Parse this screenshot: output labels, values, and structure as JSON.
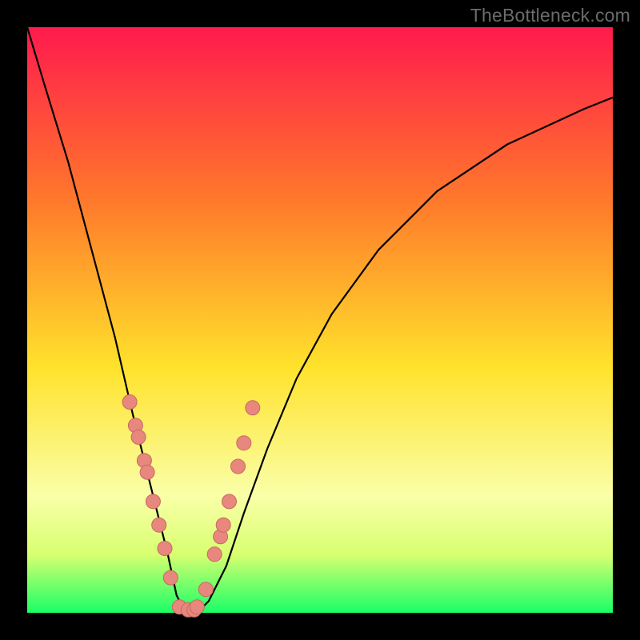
{
  "watermark": "TheBottleneck.com",
  "colors": {
    "frame": "#000000",
    "gradient_top": "#ff1a4d",
    "gradient_mid1": "#ff7a2b",
    "gradient_mid2": "#ffe22b",
    "gradient_low": "#faffa8",
    "gradient_band": "#d8ff70",
    "gradient_bottom": "#1aff66",
    "curve": "#000000",
    "marker_fill": "#e8877d",
    "marker_stroke": "#c56a60"
  },
  "chart_data": {
    "type": "line",
    "title": "",
    "xlabel": "",
    "ylabel": "",
    "xlim": [
      0,
      1
    ],
    "ylim": [
      0,
      1
    ],
    "series": [
      {
        "name": "bottleneck-curve",
        "x": [
          0.0,
          0.03,
          0.07,
          0.11,
          0.15,
          0.18,
          0.21,
          0.24,
          0.255,
          0.27,
          0.29,
          0.31,
          0.34,
          0.37,
          0.41,
          0.46,
          0.52,
          0.6,
          0.7,
          0.82,
          0.95,
          1.0
        ],
        "y": [
          1.0,
          0.9,
          0.77,
          0.62,
          0.47,
          0.34,
          0.22,
          0.1,
          0.03,
          0.0,
          0.0,
          0.02,
          0.08,
          0.17,
          0.28,
          0.4,
          0.51,
          0.62,
          0.72,
          0.8,
          0.86,
          0.88
        ]
      }
    ],
    "markers": {
      "name": "highlighted-points",
      "x": [
        0.175,
        0.185,
        0.19,
        0.2,
        0.205,
        0.215,
        0.225,
        0.235,
        0.245,
        0.26,
        0.275,
        0.285,
        0.29,
        0.305,
        0.32,
        0.33,
        0.335,
        0.345,
        0.36,
        0.37,
        0.385
      ],
      "y": [
        0.36,
        0.32,
        0.3,
        0.26,
        0.24,
        0.19,
        0.15,
        0.11,
        0.06,
        0.01,
        0.005,
        0.005,
        0.01,
        0.04,
        0.1,
        0.13,
        0.15,
        0.19,
        0.25,
        0.29,
        0.35
      ]
    }
  }
}
